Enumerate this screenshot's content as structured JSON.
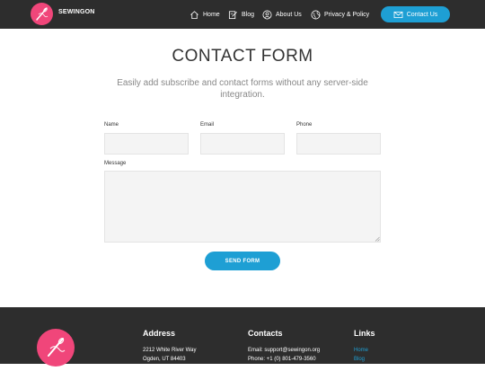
{
  "header": {
    "brand": "SEWINGON",
    "nav": [
      {
        "label": "Home",
        "icon": "home-icon"
      },
      {
        "label": "Blog",
        "icon": "edit-icon"
      },
      {
        "label": "About Us",
        "icon": "user-icon"
      },
      {
        "label": "Privacy & Policy",
        "icon": "globe-icon"
      }
    ],
    "cta_label": "Contact Us",
    "colors": {
      "brand": "#f0467a",
      "accent": "#1e9fd4",
      "bar": "#2d2d2d"
    }
  },
  "main": {
    "title": "CONTACT FORM",
    "subtitle": "Easily add subscribe and contact forms without any server-side integration.",
    "form": {
      "name_label": "Name",
      "email_label": "Email",
      "phone_label": "Phone",
      "message_label": "Message",
      "send_label": "SEND FORM"
    }
  },
  "footer": {
    "address_heading": "Address",
    "address_line1": "2212 White River Way",
    "address_line2": "Ogden, UT 84403",
    "contacts_heading": "Contacts",
    "contacts_email": "Email: support@sewingon.org",
    "contacts_phone": "Phone: +1 (0) 801-479-3560",
    "links_heading": "Links",
    "links": [
      "Home",
      "Blog"
    ]
  }
}
